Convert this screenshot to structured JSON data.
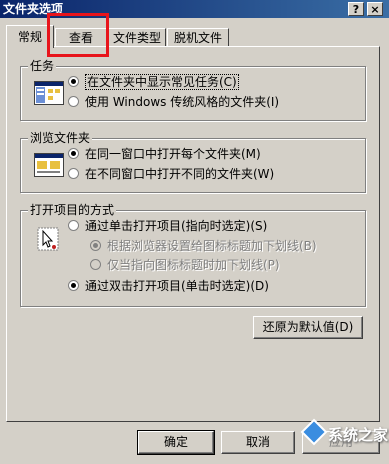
{
  "window": {
    "title": "文件夹选项",
    "help_btn": "?",
    "close_btn": "×"
  },
  "tabs": [
    {
      "label": "常规",
      "active": true
    },
    {
      "label": "查看",
      "active": false
    },
    {
      "label": "文件类型",
      "active": false
    },
    {
      "label": "脱机文件",
      "active": false
    }
  ],
  "tasks": {
    "title": "任务",
    "options": [
      {
        "label": "在文件夹中显示常见任务(C)",
        "checked": true
      },
      {
        "label": "使用 Windows 传统风格的文件夹(I)",
        "checked": false
      }
    ]
  },
  "browse": {
    "title": "浏览文件夹",
    "options": [
      {
        "label": "在同一窗口中打开每个文件夹(M)",
        "checked": true
      },
      {
        "label": "在不同窗口中打开不同的文件夹(W)",
        "checked": false
      }
    ]
  },
  "open_items": {
    "title": "打开项目的方式",
    "options": [
      {
        "label": "通过单击打开项目(指向时选定)(S)",
        "checked": false
      },
      {
        "label": "根据浏览器设置给图标标题加下划线(B)",
        "checked": true,
        "disabled": true
      },
      {
        "label": "仅当指向图标标题时加下划线(P)",
        "checked": false,
        "disabled": true
      },
      {
        "label": "通过双击打开项目(单击时选定)(D)",
        "checked": true
      }
    ]
  },
  "restore_button": "还原为默认值(D)",
  "footer": {
    "ok": "确定",
    "cancel": "取消",
    "apply": "应用"
  },
  "watermark": "系统之家",
  "colors": {
    "title_bar": "#0a246a",
    "dialog_bg": "#d4d0c8",
    "highlight_box": "#e8141b"
  }
}
